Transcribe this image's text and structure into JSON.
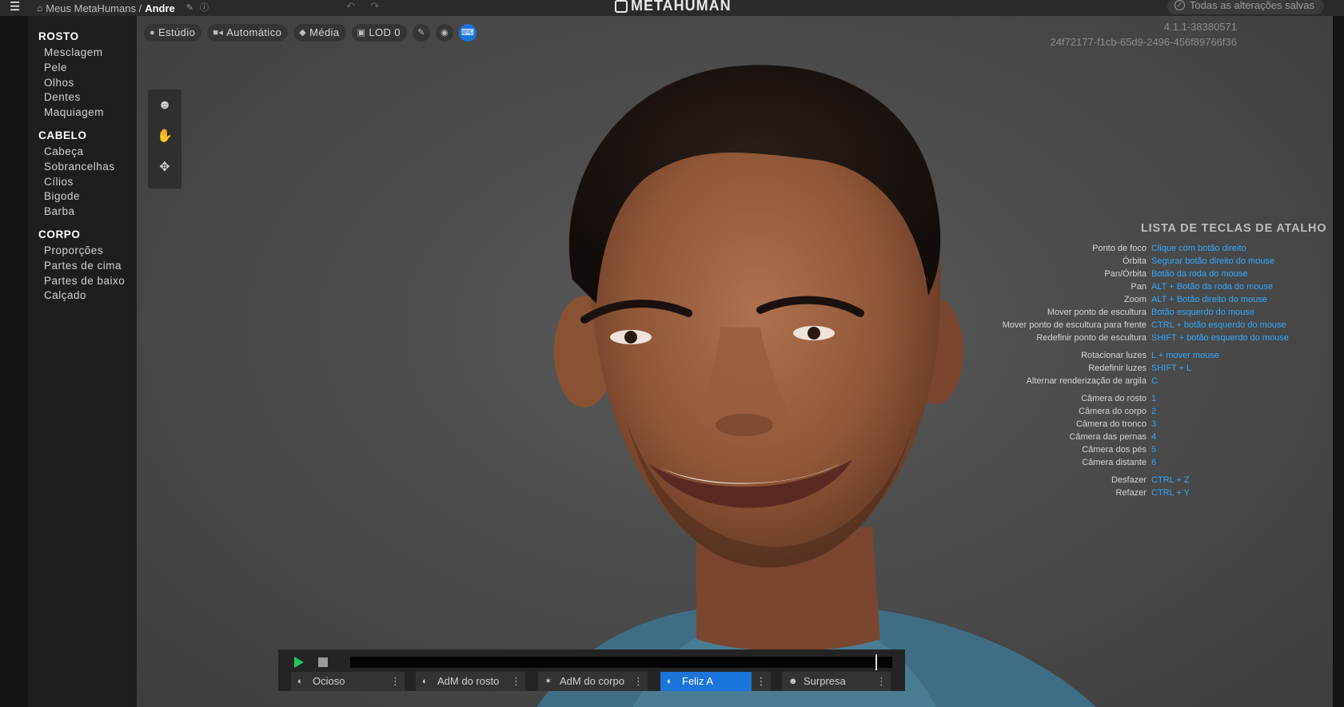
{
  "topbar": {
    "breadcrumb_root": "Meus MetaHumans /",
    "breadcrumb_current": "Andre",
    "logo_text": "METAHUMAN",
    "save_status": "Todas as alterações salvas"
  },
  "sidebar": {
    "sections": [
      {
        "title": "ROSTO",
        "items": [
          "Mesclagem",
          "Pele",
          "Olhos",
          "Dentes",
          "Maquiagem"
        ]
      },
      {
        "title": "CABELO",
        "items": [
          "Cabeça",
          "Sobrancelhas",
          "Cílios",
          "Bigode",
          "Barba"
        ]
      },
      {
        "title": "CORPO",
        "items": [
          "Proporções",
          "Partes de cima",
          "Partes de baixo",
          "Calçado"
        ]
      }
    ]
  },
  "toolbar": {
    "studio": "Estúdio",
    "auto": "Automático",
    "medium": "Média",
    "lod": "LOD 0"
  },
  "version": {
    "build": "4.1.1-38380571",
    "guid": "24f72177-f1cb-65d9-2496-456f89766f36"
  },
  "shortcuts": {
    "title": "LISTA DE TECLAS DE ATALHO",
    "rows": [
      {
        "k": "Ponto de foco",
        "v": "Clique com botão direito"
      },
      {
        "k": "Órbita",
        "v": "Segurar botão direito do mouse"
      },
      {
        "k": "Pan/Órbita",
        "v": "Botão da roda do mouse"
      },
      {
        "k": "Pan",
        "v": "ALT + Botão da roda do mouse"
      },
      {
        "k": "Zoom",
        "v": "ALT + Botão direito do mouse"
      },
      {
        "k": "Mover ponto de escultura",
        "v": "Botão esquerdo do mouse"
      },
      {
        "k": "Mover ponto de escultura para frente",
        "v": "CTRL + botão esquerdo do mouse"
      },
      {
        "k": "Redefinir ponto de escultura",
        "v": "SHIFT + botão esquerdo do mouse"
      },
      {
        "k": "Rotacionar luzes",
        "v": "L + mover mouse"
      },
      {
        "k": "Redefinir luzes",
        "v": "SHIFT + L"
      },
      {
        "k": "Alternar renderização de argila",
        "v": "C"
      },
      {
        "k": "Câmera do rosto",
        "v": "1"
      },
      {
        "k": "Câmera do corpo",
        "v": "2"
      },
      {
        "k": "Câmera do tronco",
        "v": "3"
      },
      {
        "k": "Câmera das pernas",
        "v": "4"
      },
      {
        "k": "Câmera dos pés",
        "v": "5"
      },
      {
        "k": "Câmera distante",
        "v": "6"
      },
      {
        "k": "Desfazer",
        "v": "CTRL + Z"
      },
      {
        "k": "Refazer",
        "v": "CTRL + Y"
      }
    ]
  },
  "timeline": {
    "progress": 0.97,
    "animations": [
      "Ocioso",
      "AdM do rosto",
      "AdM do corpo",
      "Feliz A",
      "Surpresa"
    ],
    "selected": "Feliz A"
  }
}
